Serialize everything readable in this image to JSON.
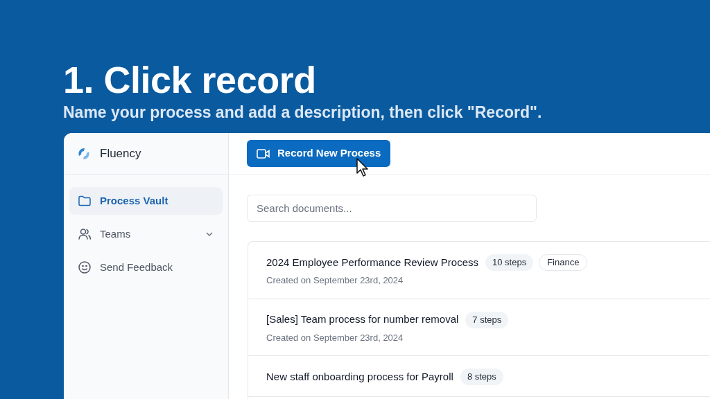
{
  "heading": "1. Click record",
  "subheading": "Name your process and add a description, then click \"Record\".",
  "app": {
    "brand": "Fluency",
    "sidebar": {
      "items": [
        {
          "label": "Process Vault",
          "kind": "folder",
          "selected": true,
          "expandable": false
        },
        {
          "label": "Teams",
          "kind": "users",
          "selected": false,
          "expandable": true
        },
        {
          "label": "Send Feedback",
          "kind": "smile",
          "selected": false,
          "expandable": false
        }
      ]
    },
    "record_button": "Record New Process",
    "search": {
      "placeholder": "Search documents..."
    },
    "documents": [
      {
        "title": "2024 Employee Performance Review Process",
        "steps": "10 steps",
        "tag": "Finance",
        "created": "Created on September 23rd, 2024"
      },
      {
        "title": "[Sales] Team process for number removal",
        "steps": "7 steps",
        "created": "Created on September 23rd, 2024"
      },
      {
        "title": "New staff onboarding process for Payroll",
        "steps": "8 steps"
      }
    ]
  }
}
